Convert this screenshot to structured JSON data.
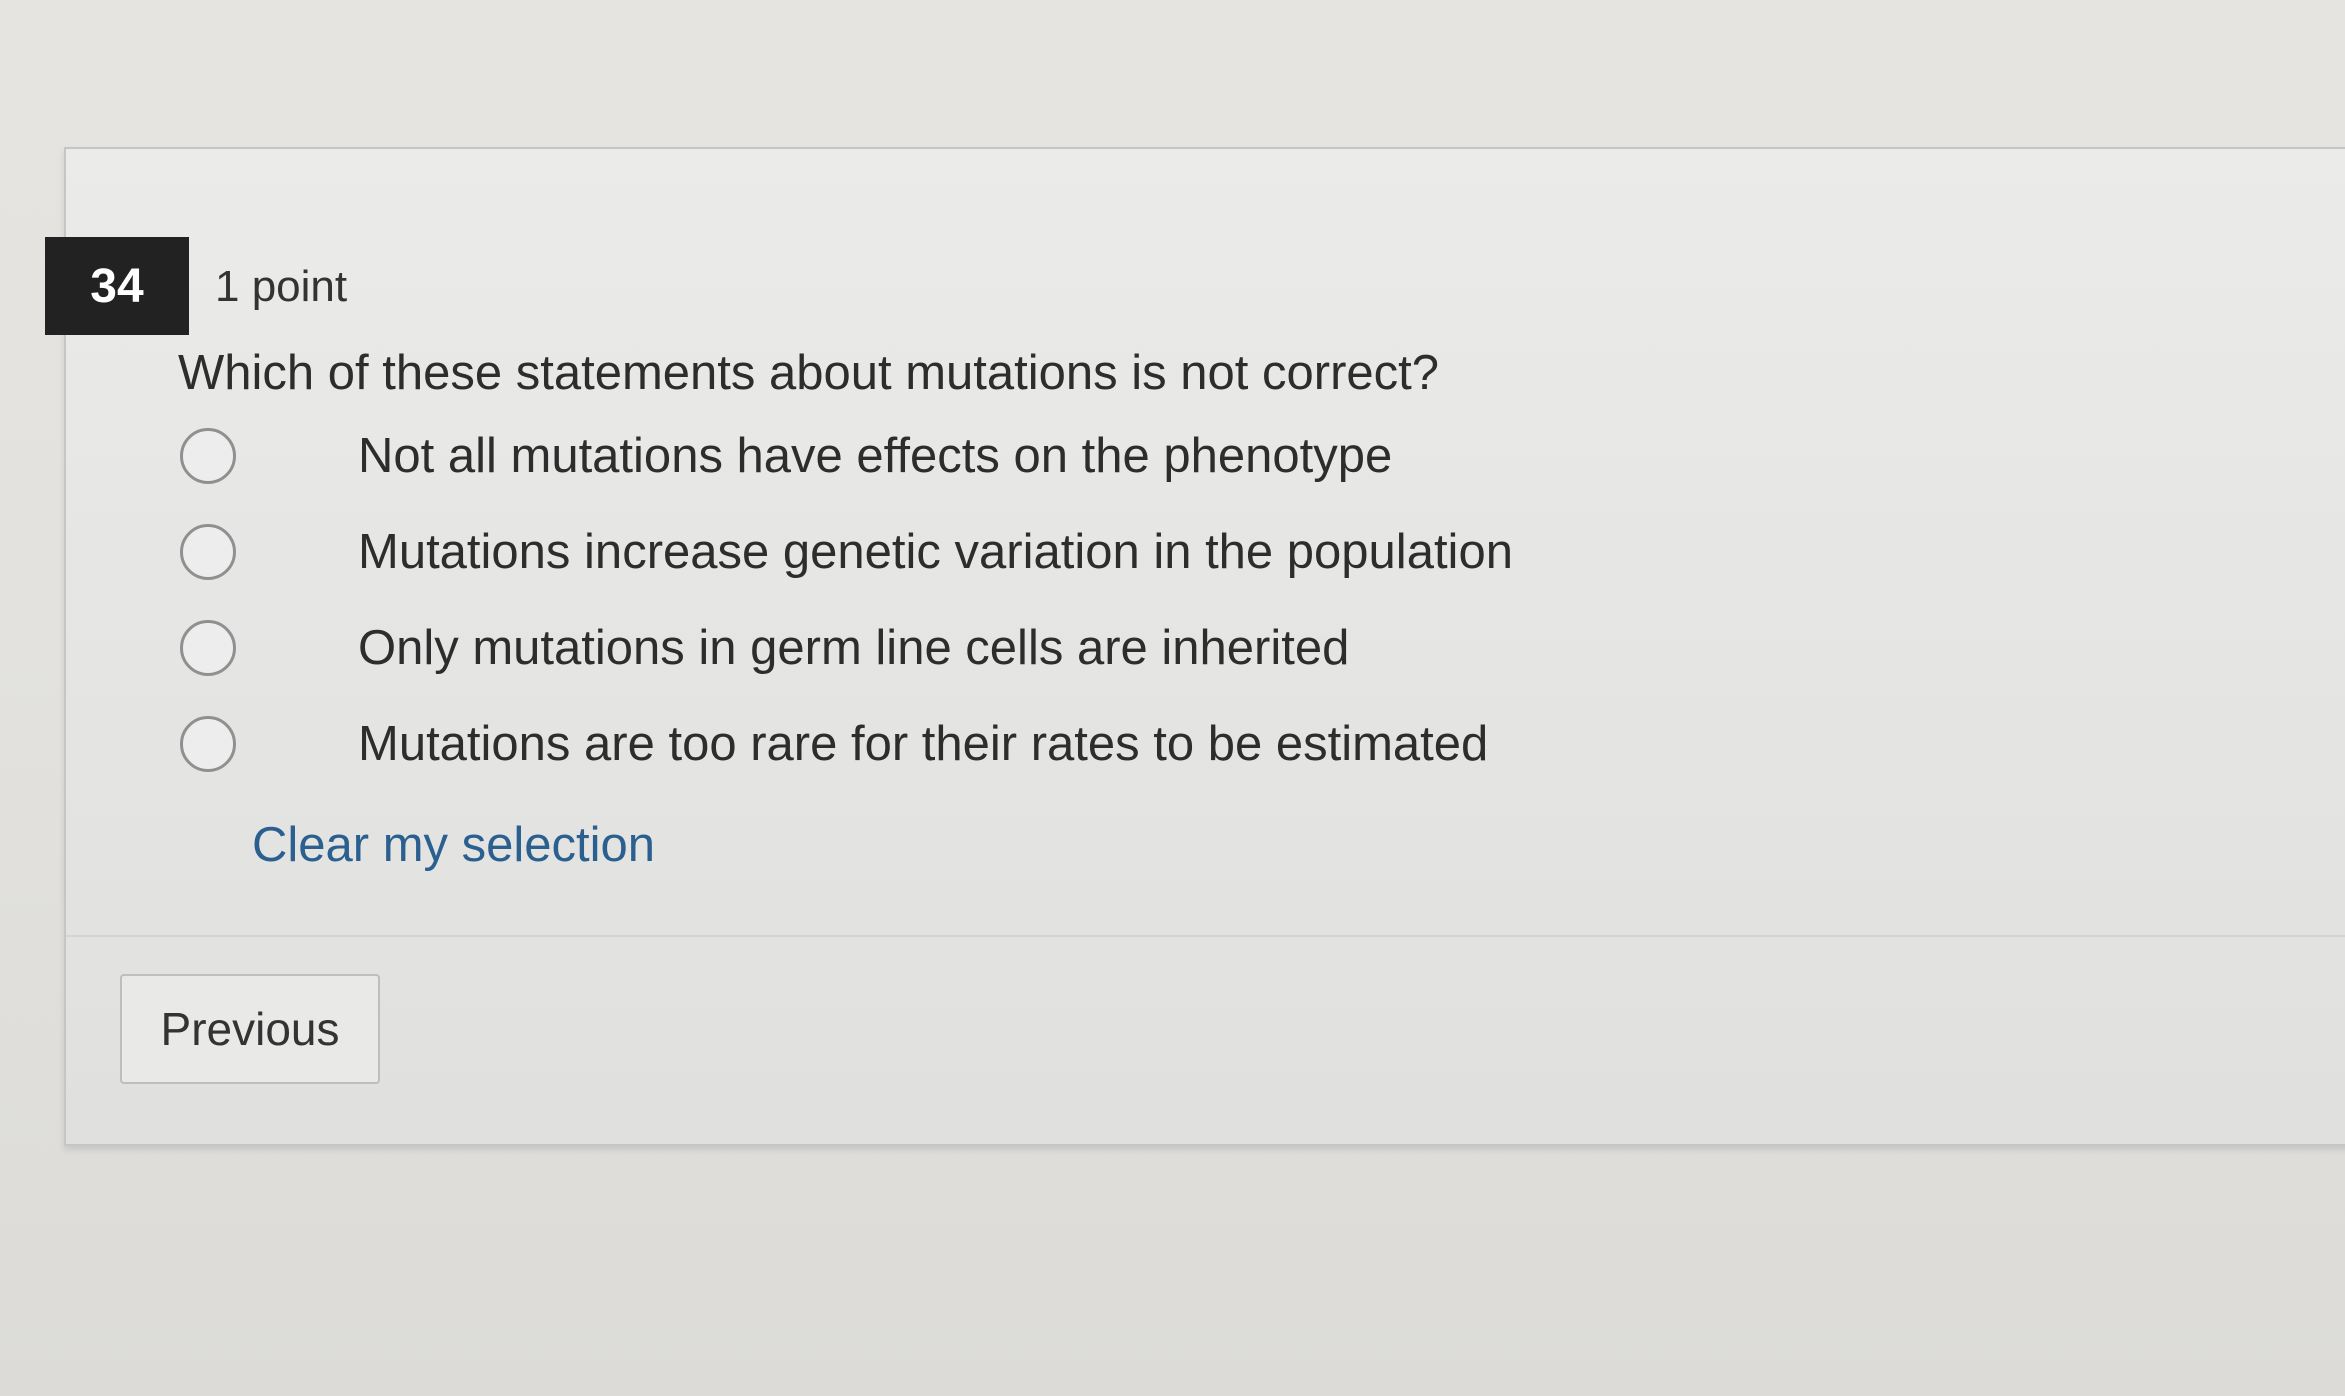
{
  "question": {
    "number": "34",
    "points": "1 point",
    "text": "Which of these statements about mutations is not correct?",
    "options": [
      {
        "label": "Not all mutations have effects on the phenotype",
        "selected": false
      },
      {
        "label": "Mutations increase genetic variation in the population",
        "selected": false
      },
      {
        "label": "Only mutations in germ line cells are inherited",
        "selected": false
      },
      {
        "label": "Mutations are too rare for their rates to be estimated",
        "selected": false
      }
    ],
    "clear_label": "Clear my selection"
  },
  "navigation": {
    "previous_label": "Previous"
  },
  "colors": {
    "link": "#2a5f8f",
    "number_badge": "#222222"
  }
}
